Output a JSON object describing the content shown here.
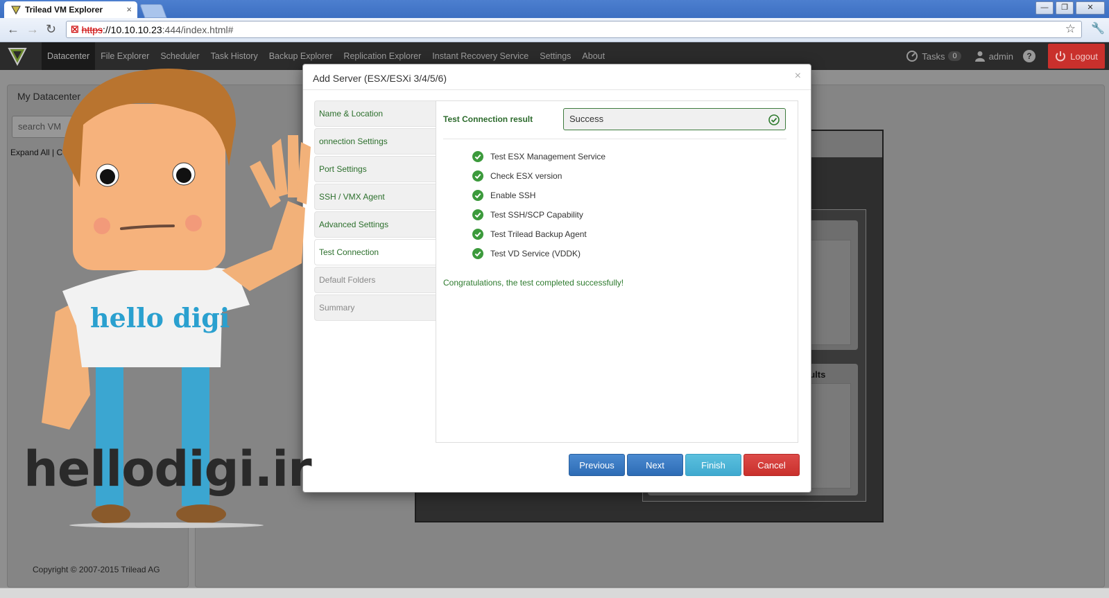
{
  "browser": {
    "tab_title": "Trilead VM Explorer",
    "tab_close": "×",
    "url_proto": "https",
    "url_host": "://10.10.10.23",
    "url_rest": ":444/index.html#",
    "window_buttons": [
      "—",
      "❐",
      "✕"
    ]
  },
  "navbar": {
    "items": [
      "Datacenter",
      "File Explorer",
      "Scheduler",
      "Task History",
      "Backup Explorer",
      "Replication Explorer",
      "Instant Recovery Service",
      "Settings",
      "About"
    ],
    "tasks_label": "Tasks",
    "tasks_count": "0",
    "user": "admin",
    "help": "?",
    "logout": "Logout"
  },
  "left_panel": {
    "title": "My Datacenter",
    "search_placeholder": "search VM",
    "expand_all": "Expand All | C",
    "copyright": "Copyright © 2007-2015 Trilead AG"
  },
  "background": {
    "results_label": "sults"
  },
  "modal": {
    "title": "Add Server (ESX/ESXi 3/4/5/6)",
    "close": "×",
    "steps": [
      {
        "label": "Name & Location",
        "state": "done"
      },
      {
        "label": "onnection Settings",
        "state": "done"
      },
      {
        "label": "Port Settings",
        "state": "done"
      },
      {
        "label": "SSH / VMX Agent",
        "state": "done"
      },
      {
        "label": "Advanced Settings",
        "state": "done"
      },
      {
        "label": "Test Connection",
        "state": "active"
      },
      {
        "label": "Default Folders",
        "state": "disabled"
      },
      {
        "label": "Summary",
        "state": "disabled"
      }
    ],
    "result_label": "Test Connection result",
    "result_value": "Success",
    "checks": [
      "Test ESX Management Service",
      "Check ESX version",
      "Enable SSH",
      "Test SSH/SCP Capability",
      "Test Trilead Backup Agent",
      "Test VD Service (VDDK)"
    ],
    "congrats": "Congratulations, the test completed successfully!",
    "buttons": {
      "previous": "Previous",
      "next": "Next",
      "finish": "Finish",
      "cancel": "Cancel"
    }
  },
  "overlay": {
    "shirt_text": "hello digi",
    "watermark": "hellodigi.ir"
  },
  "colors": {
    "success_green": "#2d7a2d",
    "check_icon": "#3c9a3c",
    "primary_blue": "#2d6cb5",
    "info_cyan": "#5bc0de",
    "danger_red": "#c9302c",
    "navbar_bg": "#2b2b2b"
  }
}
